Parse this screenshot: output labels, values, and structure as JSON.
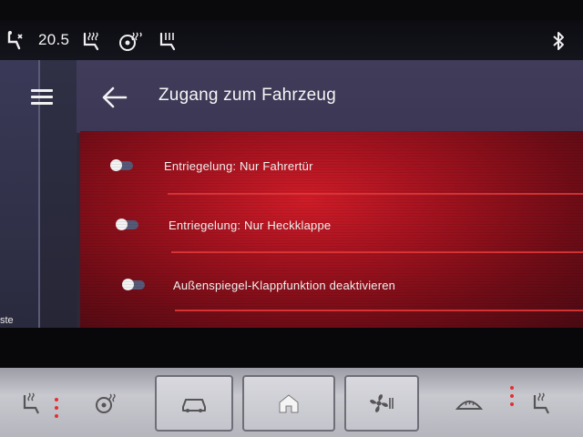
{
  "status_bar": {
    "temperature": "20.5",
    "icons": [
      "seat-climate-icon",
      "seat-heat-icon",
      "steering-wheel-heat-icon",
      "seat-ventilation-icon",
      "bluetooth-icon"
    ]
  },
  "sidebar": {
    "stub_label": "ste"
  },
  "header": {
    "title": "Zugang zum Fahrzeug"
  },
  "settings": [
    {
      "label": "Entriegelung: Nur Fahrertür",
      "enabled": false
    },
    {
      "label": "Entriegelung: Nur Heckklappe",
      "enabled": false
    },
    {
      "label": "Außenspiegel-Klappfunktion deaktivieren",
      "enabled": false
    }
  ],
  "hardware_buttons": [
    "seat-heat-left-icon",
    "steering-wheel-heat-icon",
    "car-icon",
    "home-icon",
    "fan-icon",
    "windshield-defrost-icon",
    "seat-heat-right-icon"
  ],
  "colors": {
    "accent_red": "#d01c28",
    "divider_red": "#e83a3a",
    "header_bg": "#403c5a",
    "toggle_track": "#565a78"
  }
}
